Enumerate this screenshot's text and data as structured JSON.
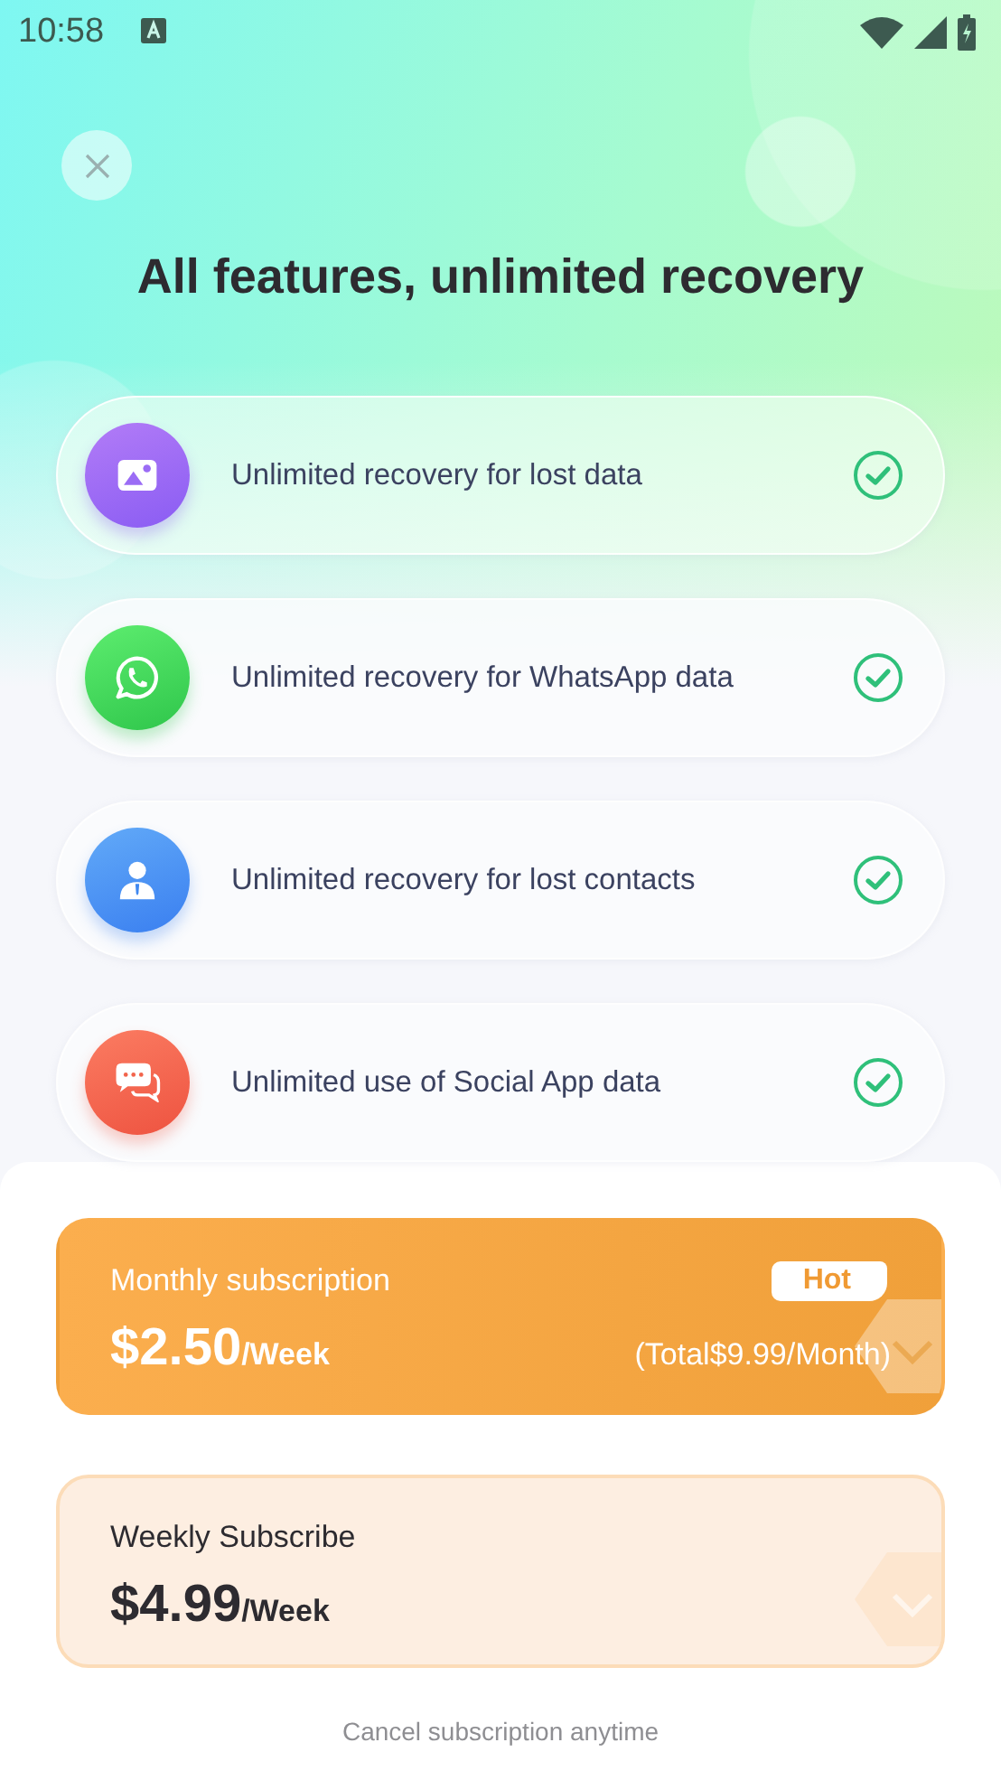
{
  "status_bar": {
    "time": "10:58"
  },
  "title": "All features, unlimited recovery",
  "features": [
    {
      "kind": "photo",
      "label": "Unlimited recovery for lost data",
      "checked": true
    },
    {
      "kind": "whatsapp",
      "label": "Unlimited recovery for WhatsApp data",
      "checked": true
    },
    {
      "kind": "contact",
      "label": "Unlimited recovery for lost contacts",
      "checked": true
    },
    {
      "kind": "chat",
      "label": "Unlimited use of Social App data",
      "checked": true
    }
  ],
  "plans": [
    {
      "name": "Monthly subscription",
      "price": "$2.50",
      "unit": "/Week",
      "badge": "Hot",
      "total": "(Total$9.99/Month)",
      "selected": true
    },
    {
      "name": "Weekly Subscribe",
      "price": "$4.99",
      "unit": "/Week",
      "selected": false
    }
  ],
  "footer_note": "Cancel subscription anytime"
}
